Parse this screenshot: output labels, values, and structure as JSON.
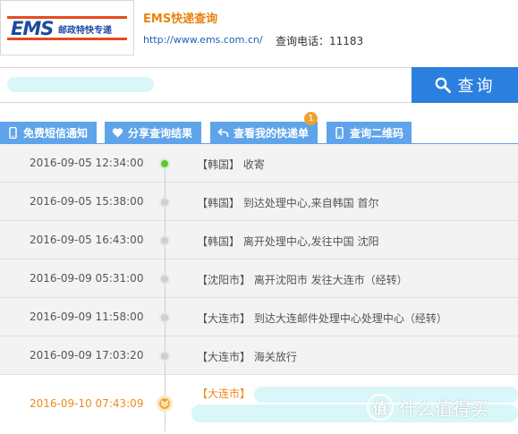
{
  "header": {
    "logo_text": "EMS",
    "logo_cn": "邮政特快专递",
    "title": "EMS快递查询",
    "url": "http://www.ems.com.cn/",
    "phone": "查询电话：11183"
  },
  "search": {
    "input_value": "",
    "button_label": "查询"
  },
  "actions": [
    {
      "label": "免费短信通知",
      "icon": "phone-icon"
    },
    {
      "label": "分享查询结果",
      "icon": "heart-icon"
    },
    {
      "label": "查看我的快递单",
      "icon": "back-arrow-icon"
    },
    {
      "label": "查询二维码",
      "icon": "phone-icon"
    }
  ],
  "badge_count": "1",
  "timeline": [
    {
      "time": "2016-09-05 12:34:00",
      "text": "【韩国】 收寄",
      "status": "first"
    },
    {
      "time": "2016-09-05 15:38:00",
      "text": "【韩国】 到达处理中心,来自韩国 首尔",
      "status": "normal"
    },
    {
      "time": "2016-09-05 16:43:00",
      "text": "【韩国】 离开处理中心,发往中国 沈阳",
      "status": "normal"
    },
    {
      "time": "2016-09-09 05:31:00",
      "text": "【沈阳市】 离开沈阳市 发往大连市（经转）",
      "status": "normal"
    },
    {
      "time": "2016-09-09 11:58:00",
      "text": "【大连市】 到达大连邮件处理中心处理中心（经转）",
      "status": "normal"
    },
    {
      "time": "2016-09-09 17:03:20",
      "text": "【大连市】 海关放行",
      "status": "normal"
    },
    {
      "time": "2016-09-10 07:43:09",
      "text": "【大连市】",
      "status": "latest"
    }
  ],
  "watermark": {
    "symbol": "值",
    "text": "什么值得买"
  },
  "colors": {
    "accent_blue": "#2b7fde",
    "action_blue": "#5fa4ea",
    "orange": "#f08a1c",
    "green": "#62c630"
  }
}
